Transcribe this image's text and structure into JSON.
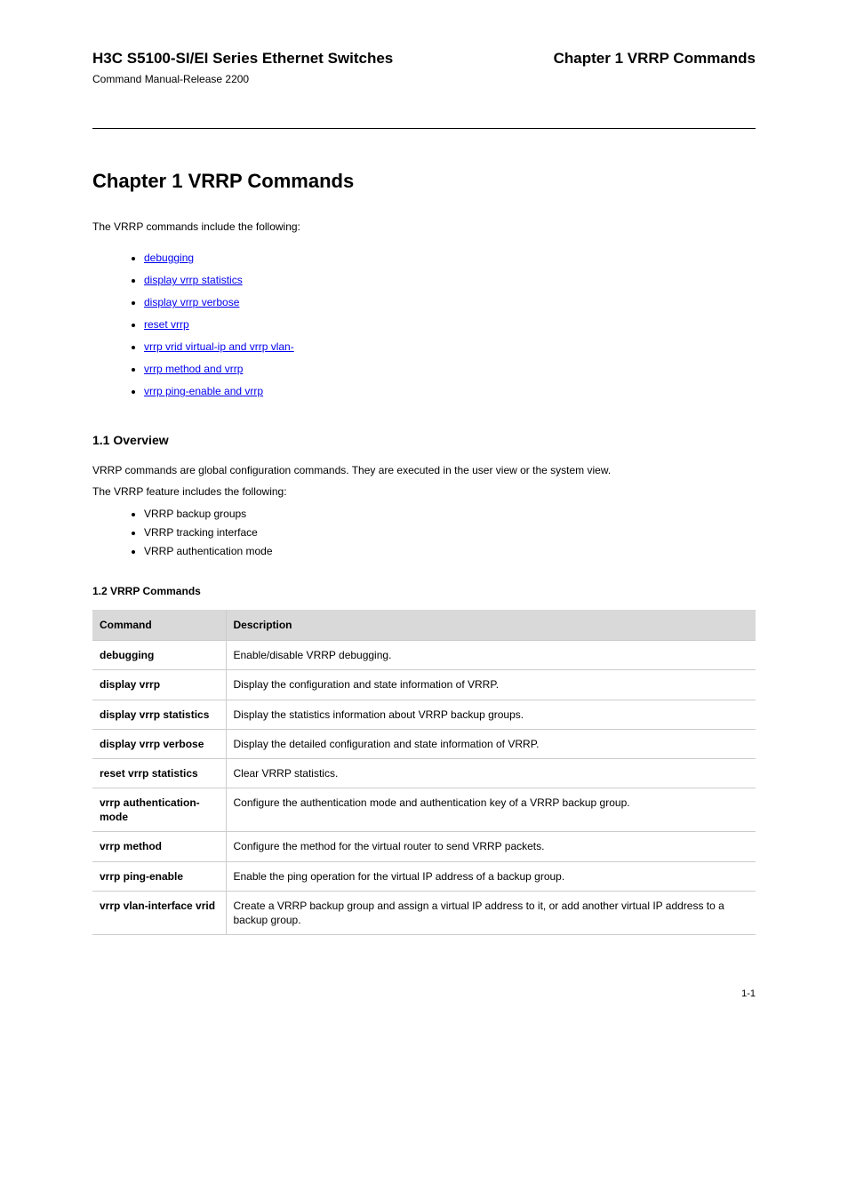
{
  "header": {
    "title": "H3C S5100-SI/EI Series Ethernet Switches",
    "subtitle": "Command Manual-Release 2200",
    "chapter": "Chapter 1 VRRP Commands"
  },
  "section_title": "Chapter 1 VRRP Commands",
  "intro": "The VRRP commands include the following:",
  "toc": [
    "debugging",
    "display vrrp statistics",
    "display vrrp verbose",
    "reset vrrp",
    "vrrp vrid virtual-ip and vrrp vlan-",
    "vrrp method and vrrp",
    "vrrp ping-enable and vrrp"
  ],
  "overview": {
    "heading": "1.1  Overview",
    "p1": "VRRP commands are global configuration commands. They are executed in the user view or the system view.",
    "p2": "The VRRP feature includes the following:",
    "items": [
      "VRRP backup groups",
      "VRRP tracking interface",
      "VRRP authentication mode"
    ]
  },
  "commands": {
    "heading": "1.2  VRRP Commands",
    "table_header": [
      "Command",
      "Description"
    ],
    "rows": [
      [
        "debugging",
        "Enable/disable VRRP debugging."
      ],
      [
        "display vrrp",
        "Display the configuration and state information of VRRP."
      ],
      [
        "display vrrp statistics",
        "Display the statistics information about VRRP backup groups."
      ],
      [
        "display vrrp verbose",
        "Display the detailed configuration and state information of VRRP."
      ],
      [
        "reset vrrp statistics",
        "Clear VRRP statistics."
      ],
      [
        "vrrp authentication-mode",
        "Configure the authentication mode and authentication key of a VRRP backup group."
      ],
      [
        "vrrp method",
        "Configure the method for the virtual router to send VRRP packets."
      ],
      [
        "vrrp ping-enable",
        "Enable the ping operation for the virtual IP address of a backup group."
      ],
      [
        "vrrp vlan-interface vrid",
        "Create a VRRP backup group and assign a virtual IP address to it, or add another virtual IP address to a backup group."
      ]
    ]
  },
  "footer": "1-1"
}
